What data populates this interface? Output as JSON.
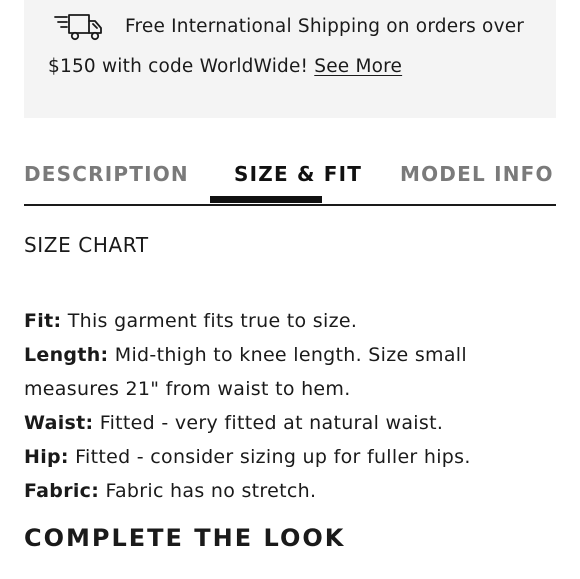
{
  "banner": {
    "icon": "delivery-truck-icon",
    "line1": "Free International Shipping on orders over",
    "line2": "$150 with code WorldWide!",
    "link_label": "See More"
  },
  "tabs": [
    {
      "label": "DESCRIPTION",
      "active": false
    },
    {
      "label": "SIZE & FIT",
      "active": true
    },
    {
      "label": "MODEL INFO",
      "active": false
    }
  ],
  "size_fit": {
    "heading": "SIZE CHART",
    "details": [
      {
        "label": "Fit:",
        "text": "This garment fits true to size."
      },
      {
        "label": "Length:",
        "text": "Mid-thigh to knee length. Size small",
        "continued": "measures 21\" from waist to hem."
      },
      {
        "label": "Waist:",
        "text": "Fitted - very fitted at natural waist."
      },
      {
        "label": "Hip:",
        "text": "Fitted - consider sizing up for fuller hips."
      },
      {
        "label": "Fabric:",
        "text": "Fabric has no stretch."
      }
    ]
  },
  "complete_the_look": "COMPLETE THE LOOK",
  "colors": {
    "banner_bg": "#f4f4f4",
    "active_tab": "#111111",
    "inactive_tab": "#7a7a7a"
  }
}
